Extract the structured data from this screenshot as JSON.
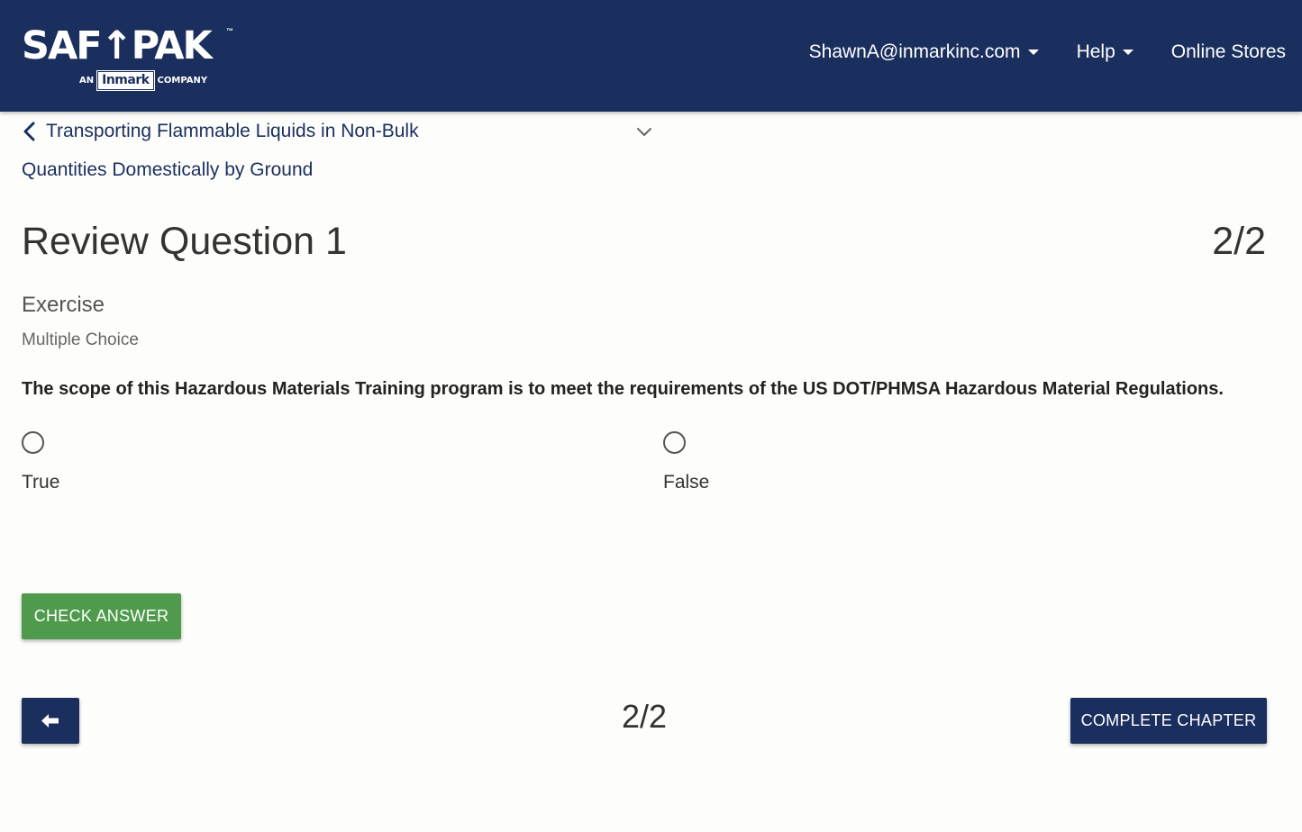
{
  "header": {
    "logo": {
      "wordmark": "SAF↑PAK",
      "tm": "™",
      "sub_prefix": "AN",
      "sub_brand": "Inmark",
      "sub_suffix": "COMPANY"
    },
    "nav": {
      "account_label": "ShawnA@inmarkinc.com",
      "help_label": "Help",
      "stores_label": "Online Stores"
    }
  },
  "chapter": {
    "title_line1": "Transporting Flammable Liquids in Non-Bulk",
    "title_line2": "Quantities Domestically by Ground",
    "back_icon": "chevron-left-icon",
    "expand_icon": "chevron-down-icon"
  },
  "question": {
    "title": "Review Question 1",
    "counter": "2/2",
    "section": "Exercise",
    "type": "Multiple Choice",
    "text": "The scope of this Hazardous Materials Training program is to meet the requirements of the US DOT/PHMSA Hazardous Material Regulations.",
    "options": [
      {
        "label": "True",
        "selected": false
      },
      {
        "label": "False",
        "selected": false
      }
    ]
  },
  "actions": {
    "check_label": "CHECK ANSWER",
    "prev_icon": "arrow-left-icon",
    "footer_counter": "2/2",
    "complete_label": "COMPLETE CHAPTER"
  },
  "colors": {
    "header_bg": "#1b2f5e",
    "accent_green": "#4f9a4c",
    "link_blue": "#1b2f5e",
    "page_bg": "#fdfdfb"
  }
}
